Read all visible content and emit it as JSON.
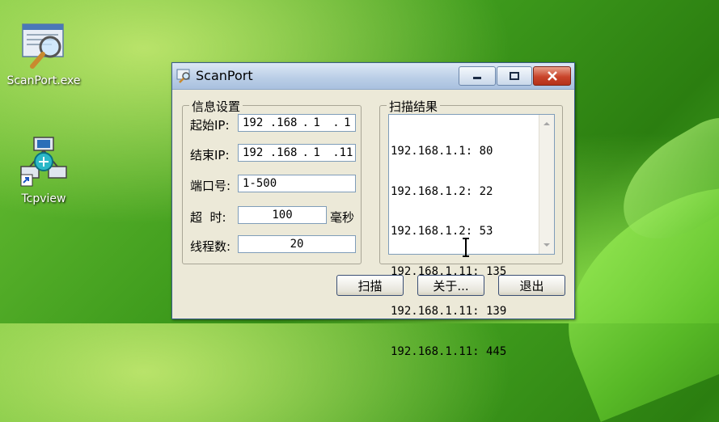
{
  "desktop": {
    "icons": [
      {
        "label": "ScanPort.exe",
        "icon": "scanport-exe-icon"
      },
      {
        "label": "Tcpview",
        "icon": "tcpview-icon"
      }
    ]
  },
  "window": {
    "title": "ScanPort",
    "buttons": {
      "minimize": "minimize-icon",
      "maximize": "maximize-icon",
      "close": "close-icon"
    }
  },
  "info": {
    "legend": "信息设置",
    "start_ip_label": "起始IP:",
    "start_ip": [
      "192",
      ".168",
      ".",
      "1",
      ".",
      "1"
    ],
    "end_ip_label": "结束IP:",
    "end_ip": [
      "192",
      ".168",
      ".",
      "1",
      ".11"
    ],
    "port_label": "端口号:",
    "port_value": "1-500",
    "timeout_label": "超  时:",
    "timeout_value": "100",
    "timeout_unit": "毫秒",
    "threads_label": "线程数:",
    "threads_value": "20"
  },
  "results": {
    "legend": "扫描结果",
    "lines": [
      "192.168.1.1: 80",
      "192.168.1.2: 22",
      "192.168.1.2: 53",
      "192.168.1.11: 135",
      "192.168.1.11: 139",
      "192.168.1.11: 445"
    ]
  },
  "actions": {
    "scan": "扫描",
    "about": "关于...",
    "exit": "退出"
  }
}
